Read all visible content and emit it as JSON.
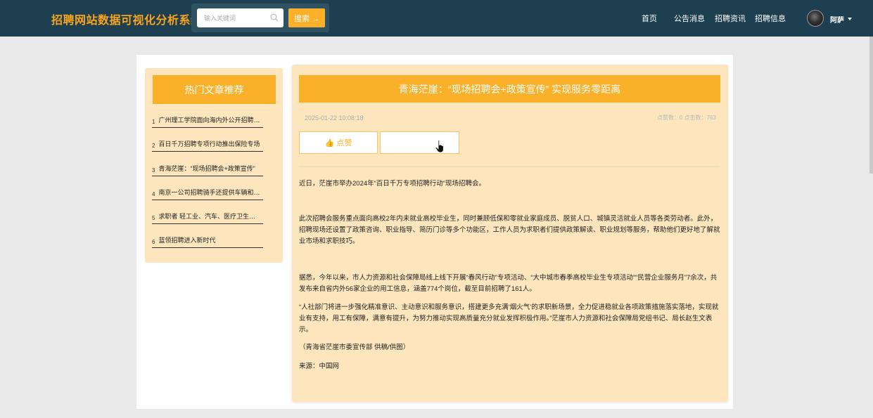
{
  "header": {
    "brand": "招聘网站数据可视化分析系统",
    "search_placeholder": "输入关键词",
    "search_button": "搜索 →",
    "nav": [
      "首页",
      "公告消息",
      "招聘资讯",
      "招聘信息"
    ],
    "username": "阿萨"
  },
  "sidebar": {
    "title": "热门文章推荐",
    "items": [
      {
        "num": "1",
        "label": "广州理工学院面向海内外公开招聘高层次人才"
      },
      {
        "num": "2",
        "label": "百日千万招聘专项行动推出保险专场"
      },
      {
        "num": "3",
        "label": "青海茫崖：“现场招聘会+政策宣传”"
      },
      {
        "num": "4",
        "label": "南京一公司招聘骑手还提供车辆和住宿"
      },
      {
        "num": "5",
        "label": "求职者 轻工业、汽车、医疗卫生行业"
      },
      {
        "num": "6",
        "label": "蓝领招聘进入新时代"
      }
    ]
  },
  "article": {
    "title": "青海茫崖：“现场招聘会+政策宣传” 实现服务零距离",
    "date": "2025-01-22 10:08:18",
    "stats": "点赞数：0    点击数：763",
    "like_label": "👍 点赞",
    "paragraphs": [
      "近日，茫崖市举办2024年“百日千万专项招聘行动”现场招聘会。",
      "此次招聘会服务重点面向高校2年内未就业高校毕业生，同时兼顾低保和零就业家庭成员、脱贫人口、城镇灵活就业人员等各类劳动者。此外，招聘现场还设置了政策咨询、职业指导、简历门诊等多个功能区，工作人员为求职者们提供政策解读、职业规划等服务，帮助他们更好地了解就业市场和求职技巧。",
      "据悉，今年以来，市人力资源和社会保障局线上线下开展“春风行动”专项活动、“大中城市春季高校毕业生专项活动”“民营企业服务月”7余次，共发布来自省内外56家企业的用工信息，涵盖774个岗位，截至目前招聘了161人。",
      "“人社部门将进一步强化精准意识、主动意识和服务意识，搭建更多充满‘烟火气’的求职新场景，全力促进稳就业各项政策措施落实落地，实现就业有支持，用工有保障，满意有提升，为努力推动实现高质量充分就业发挥积极作用。”茫崖市人力资源和社会保障局党组书记、局长赵生文表示。",
      "（青海省茫崖市委宣传部 供稿/供图）",
      "来源：中国网"
    ]
  },
  "colors": {
    "header_bg": "#1d3f4f",
    "brand": "#f8a51c",
    "accent": "#fbb02a",
    "panel_bg": "#fde6bd"
  },
  "icons": [
    "search-icon",
    "thumbs-up-icon",
    "pointer-cursor-icon",
    "chevron-down-icon"
  ]
}
